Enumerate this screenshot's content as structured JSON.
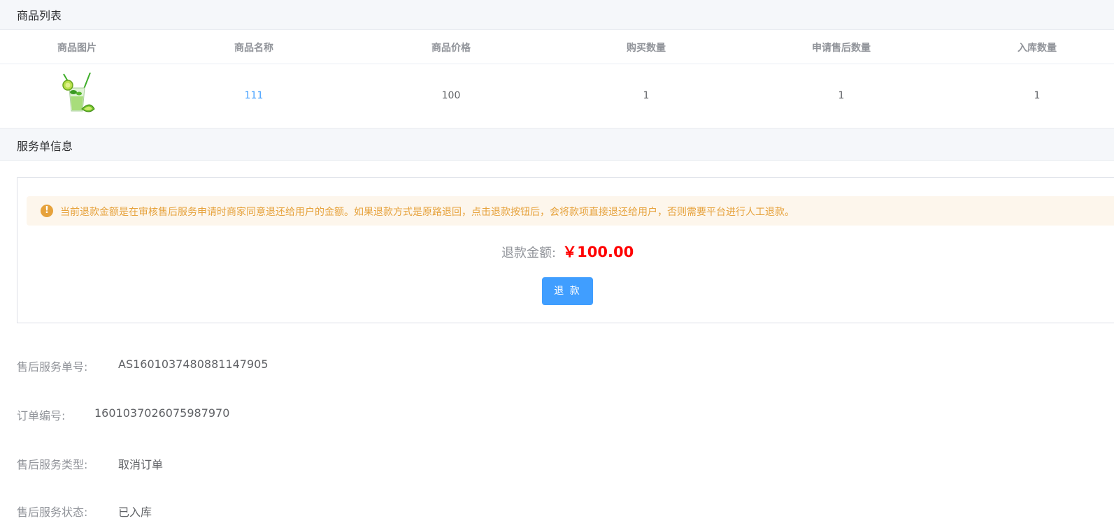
{
  "goods_section": {
    "title": "商品列表"
  },
  "goods_table": {
    "headers": [
      "商品图片",
      "商品名称",
      "商品价格",
      "购买数量",
      "申请售后数量",
      "入库数量"
    ],
    "rows": [
      {
        "name": "111",
        "price": "100",
        "buy_qty": "1",
        "aftersale_qty": "1",
        "stock_qty": "1"
      }
    ]
  },
  "service_section": {
    "title": "服务单信息"
  },
  "refund": {
    "alert": "当前退款金额是在审核售后服务申请时商家同意退还给用户的金额。如果退款方式是原路退回，点击退款按钮后，会将款项直接退还给用户，否则需要平台进行人工退款。",
    "amount_label": "退款金额:",
    "amount_value": "￥100.00",
    "button_label": "退 款"
  },
  "info": [
    {
      "label": "售后服务单号:",
      "value": "AS1601037480881147905"
    },
    {
      "label": "订单编号:",
      "value": "1601037026075987970"
    },
    {
      "label": "售后服务类型:",
      "value": "取消订单"
    },
    {
      "label": "售后服务状态:",
      "value": "已入库"
    }
  ],
  "colors": {
    "primary": "#409eff",
    "warning": "#e6a23c",
    "amount": "#ff0000"
  }
}
